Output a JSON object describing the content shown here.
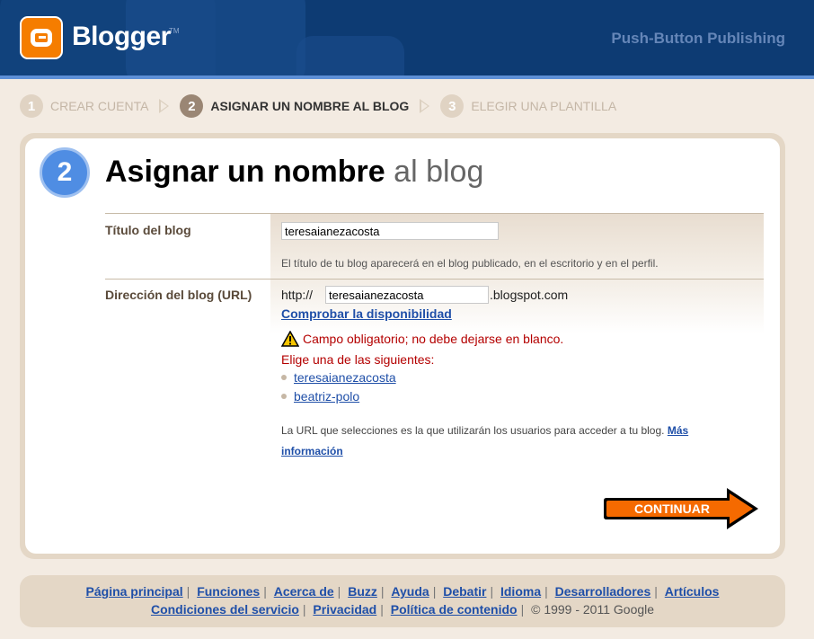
{
  "header": {
    "logo_text": "Blogger",
    "logo_tm": "TM",
    "tagline": "Push-Button Publishing"
  },
  "steps": [
    {
      "num": "1",
      "label": "CREAR CUENTA",
      "active": false
    },
    {
      "num": "2",
      "label": "ASIGNAR UN NOMBRE AL BLOG",
      "active": true
    },
    {
      "num": "3",
      "label": "ELEGIR UNA PLANTILLA",
      "active": false
    }
  ],
  "main": {
    "step_num": "2",
    "title_bold": "Asignar un nombre",
    "title_light": "al blog"
  },
  "form": {
    "title_label": "Título del blog",
    "title_value": "teresaianezacosta",
    "title_hint": "El título de tu blog aparecerá en el blog publicado, en el escritorio y en el perfil.",
    "url_label": "Dirección del blog (URL)",
    "url_prefix": "http://",
    "url_value": "teresaianezacosta",
    "url_suffix": ".blogspot.com",
    "check_link": "Comprobar la disponibilidad",
    "error": "Campo obligatorio; no debe dejarse en blanco.",
    "choose": "Elige una de las siguientes:",
    "suggestions": [
      "teresaianezacosta",
      "beatriz-polo"
    ],
    "info_text": "La URL que selecciones es la que utilizarán los usuarios para acceder a tu blog.",
    "info_link": "Más información"
  },
  "continue_label": "CONTINUAR",
  "footer": {
    "links_row1": [
      "Página principal",
      "Funciones",
      "Acerca de",
      "Buzz",
      "Ayuda",
      "Debatir",
      "Idioma",
      "Desarrolladores",
      "Artículos"
    ],
    "links_row2": [
      "Condiciones del servicio",
      "Privacidad",
      "Política de contenido"
    ],
    "copyright": "© 1999 - 2011 Google"
  },
  "colors": {
    "header_bg": "#0d3b73",
    "accent_orange": "#f57d00",
    "step_blue": "#4f8de3",
    "error_red": "#b40000",
    "link_blue": "#1f4fa8"
  }
}
